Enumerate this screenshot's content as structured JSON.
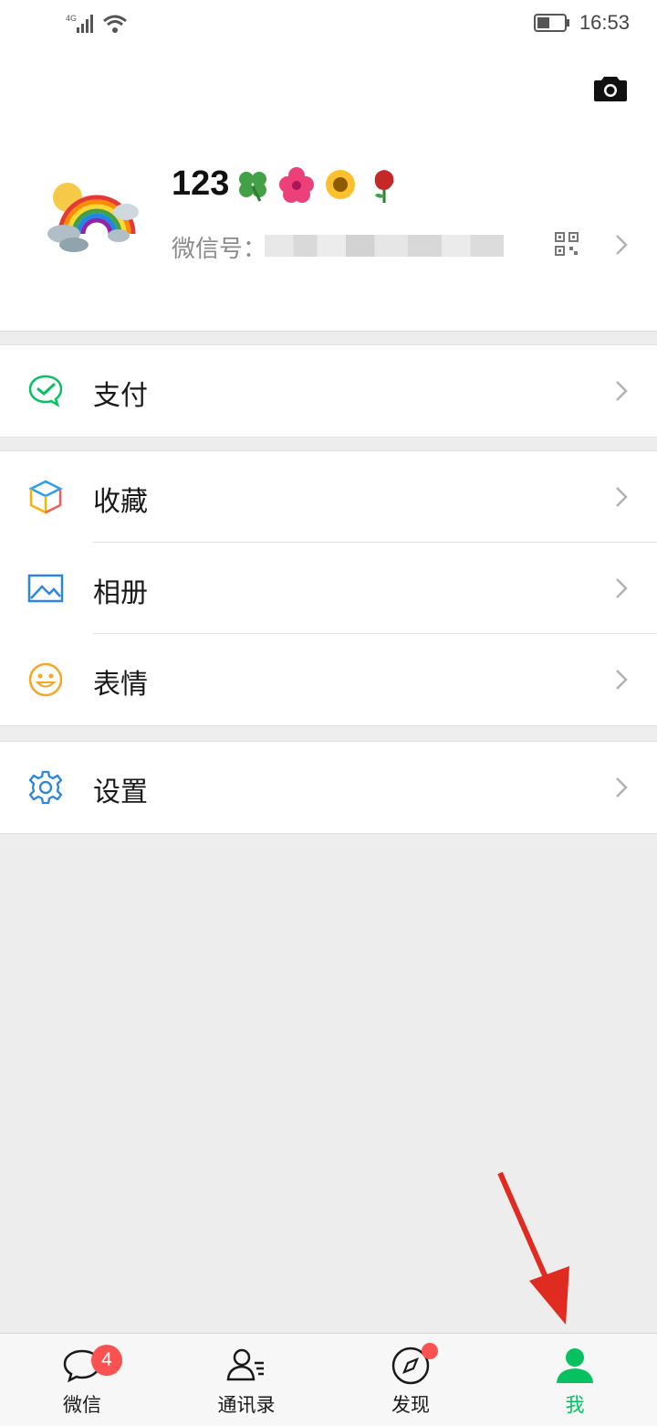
{
  "status_bar": {
    "network": "4G",
    "time": "16:53",
    "battery_level": 0.45
  },
  "profile": {
    "nickname": "123",
    "nickname_emojis": [
      "four-leaf-clover",
      "hibiscus",
      "sunflower",
      "rose"
    ],
    "wechat_id_label": "微信号：",
    "avatar_image": "rainbow-cloud-avatar"
  },
  "menu": {
    "pay": {
      "label": "支付",
      "icon": "wechat-pay-icon"
    },
    "favorites": {
      "label": "收藏",
      "icon": "cube-icon"
    },
    "album": {
      "label": "相册",
      "icon": "picture-icon"
    },
    "stickers": {
      "label": "表情",
      "icon": "smiley-icon"
    },
    "settings": {
      "label": "设置",
      "icon": "gear-icon"
    }
  },
  "tabbar": {
    "chats": {
      "label": "微信",
      "badge": "4"
    },
    "contacts": {
      "label": "通讯录"
    },
    "discover": {
      "label": "发现",
      "dot": true
    },
    "me": {
      "label": "我",
      "active": true
    }
  },
  "colors": {
    "accent": "#07c160",
    "badge": "#fa5151",
    "annotation_arrow": "#e02b20"
  }
}
